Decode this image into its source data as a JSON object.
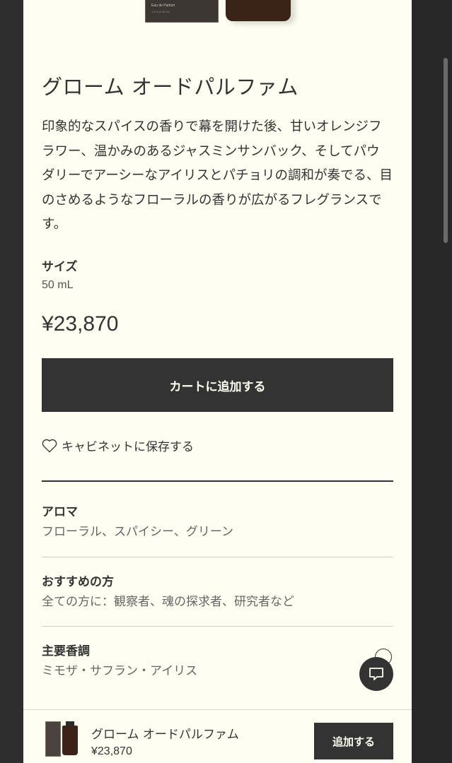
{
  "product": {
    "hero_box_label": "Eau de Parfum",
    "hero_box_sub": "1.6 fl oz   50 mL",
    "title": "グローム オードパルファム",
    "description": "印象的なスパイスの香りで幕を開けた後、甘いオレンジフラワー、温かみのあるジャスミンサンバック、そしてパウダリーでアーシーなアイリスとパチョリの調和が奏でる、目のさめるようなフローラルの香りが広がるフレグランスです。",
    "size_label": "サイズ",
    "size_value": "50 mL",
    "price": "¥23,870",
    "cart_button_label": "カートに追加する",
    "save_label": "キャビネットに保存する"
  },
  "details": [
    {
      "heading": "アロマ",
      "value": "フローラル、スパイシー、グリーン"
    },
    {
      "heading": "おすすめの方",
      "value": "全ての方に：観察者、魂の探求者、研究者など"
    },
    {
      "heading": "主要香調",
      "value": "ミモザ・サフラン・アイリス"
    }
  ],
  "sticky_bar": {
    "name": "グローム オードパルファム",
    "price": "¥23,870",
    "add_label": "追加する"
  },
  "icons": {
    "save": "heart-outline-icon",
    "chat": "chat-bubble-icon"
  },
  "colors": {
    "page_bg": "#fffef2",
    "text": "#333333",
    "button_bg": "#333333",
    "button_text": "#fffef2",
    "muted": "#666666"
  }
}
